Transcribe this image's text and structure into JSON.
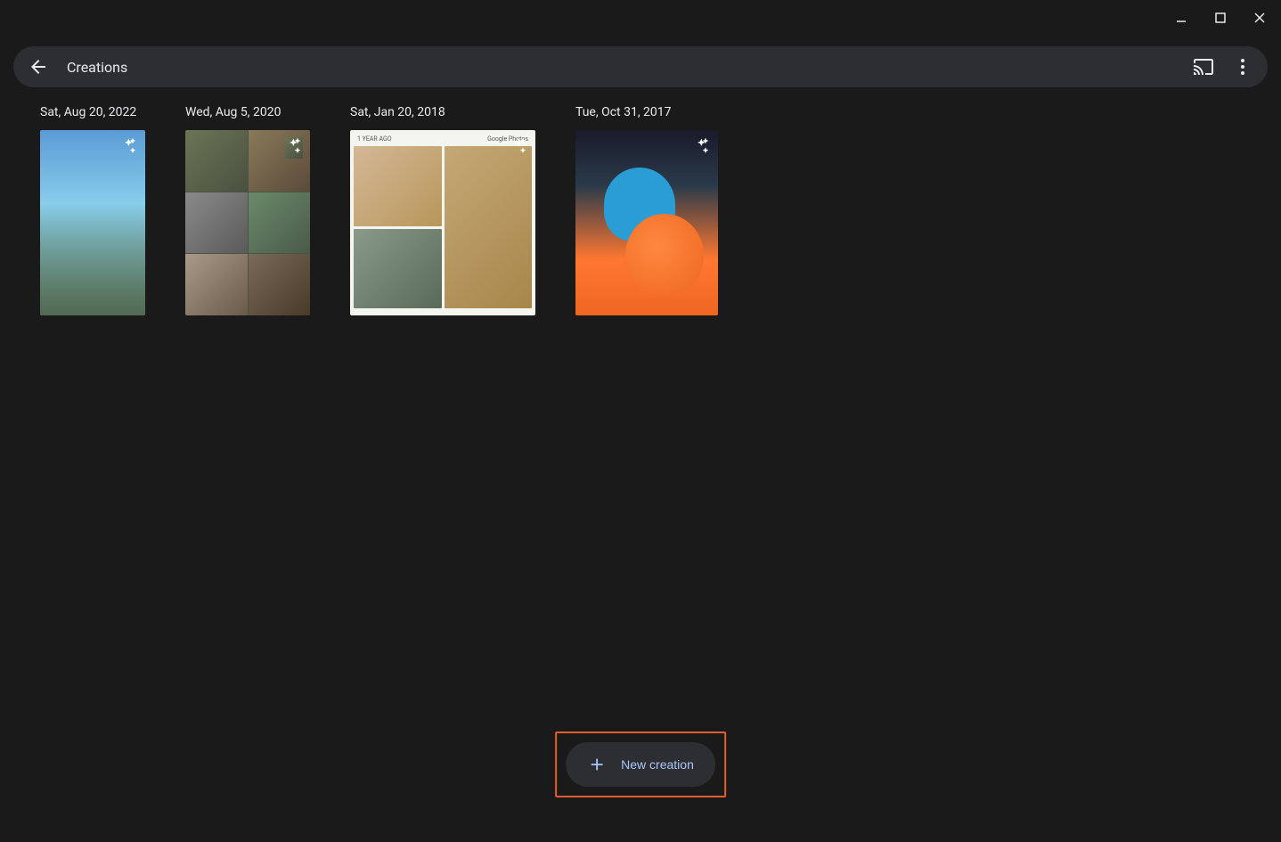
{
  "header": {
    "title": "Creations"
  },
  "creations": [
    {
      "date": "Sat, Aug 20, 2022"
    },
    {
      "date": "Wed, Aug 5, 2020"
    },
    {
      "date": "Sat, Jan 20, 2018",
      "overlay_label": "1 YEAR AGO",
      "overlay_brand": "Google Photos"
    },
    {
      "date": "Tue, Oct 31, 2017"
    }
  ],
  "actions": {
    "new_creation": "New creation"
  }
}
